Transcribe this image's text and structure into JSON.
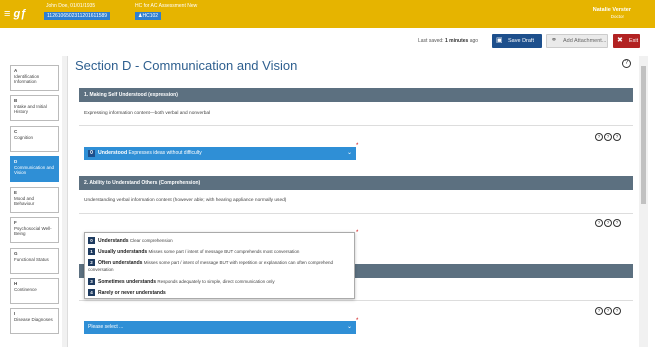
{
  "header": {
    "patient_name": "John Doe, 01/01/1935",
    "patient_id": "1126106502311201611589",
    "assessment_title": "HC for AC Assessment   New",
    "assessment_badge": "HC102",
    "user_name": "Natalie Verster",
    "user_role": "Doctor"
  },
  "toolbar": {
    "last_saved_prefix": "Last saved:",
    "last_saved_value": "1 minutes",
    "last_saved_suffix": "ago",
    "save_label": "Save Draft",
    "attach_label": "Add Attachment...",
    "exit_label": "Exit"
  },
  "nav": [
    {
      "letter": "A",
      "label": "Identification Information"
    },
    {
      "letter": "B",
      "label": "Intake and Initial History"
    },
    {
      "letter": "C",
      "label": "Cognition"
    },
    {
      "letter": "D",
      "label": "Communication and Vision"
    },
    {
      "letter": "E",
      "label": "Mood and Behaviour"
    },
    {
      "letter": "F",
      "label": "Psychosocial Well-Being"
    },
    {
      "letter": "G",
      "label": "Functional Status"
    },
    {
      "letter": "H",
      "label": "Continence"
    },
    {
      "letter": "I",
      "label": "Disease Diagnoses"
    }
  ],
  "section": {
    "title": "Section D - Communication and Vision",
    "help": "?"
  },
  "questions": [
    {
      "title": "1. Making Self Understood (expression)",
      "desc": "Expressing information content—both verbal and nonverbal",
      "selected_code": "0",
      "selected_label": "Understood",
      "selected_desc": "Expresses ideas without difficulty"
    },
    {
      "title": "2. Ability to Understand Others (Comprehension)",
      "desc": "Understanding verbal information content (however able; with hearing appliance normally used)"
    },
    {
      "placeholder": "Please select ..."
    }
  ],
  "info_icons": [
    "?",
    "?",
    "?"
  ],
  "dropdown_options": [
    {
      "code": "0",
      "label": "Understands",
      "desc": "Clear comprehension"
    },
    {
      "code": "1",
      "label": "Usually understands",
      "desc": "Misses some part / intent of message BUT comprehends most conversation"
    },
    {
      "code": "2",
      "label": "Often understands",
      "desc": "Misses some part / intent of message BUT with repetition or explanation can often comprehend conversation"
    },
    {
      "code": "3",
      "label": "Sometimes understands",
      "desc": "Responds adequately to simple, direct communication only"
    },
    {
      "code": "4",
      "label": "Rarely or never understands",
      "desc": ""
    }
  ],
  "colors": {
    "topbar": "#e6b400",
    "accent_blue": "#2f8fd6",
    "dark_blue": "#1d4f8c",
    "exit_red": "#b22222",
    "question_header": "#5c7080"
  }
}
